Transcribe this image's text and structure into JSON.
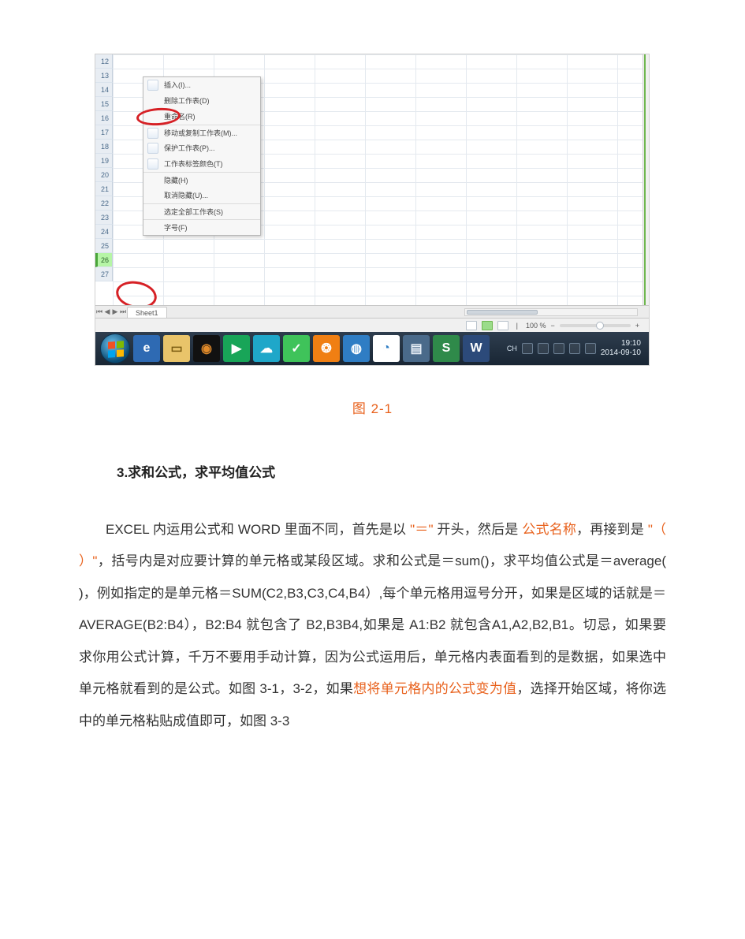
{
  "rows": [
    "12",
    "13",
    "14",
    "15",
    "16",
    "17",
    "18",
    "19",
    "20",
    "21",
    "22",
    "23",
    "24",
    "25",
    "26",
    "27"
  ],
  "selected_row_index": 14,
  "context_menu": {
    "items": [
      {
        "label": "插入(I)...",
        "icon": true
      },
      {
        "label": "删除工作表(D)"
      },
      {
        "label": "重命名(R)"
      },
      {
        "label": "移动或复制工作表(M)...",
        "icon": true,
        "sep": true
      },
      {
        "label": "保护工作表(P)...",
        "icon": true
      },
      {
        "label": "工作表标签颜色(T)",
        "icon": true
      },
      {
        "label": "隐藏(H)",
        "sep": true
      },
      {
        "label": "取消隐藏(U)..."
      },
      {
        "label": "选定全部工作表(S)",
        "sep": true
      },
      {
        "label": "字号(F)",
        "sep": true
      }
    ]
  },
  "tabs": {
    "sheet": "Sheet1"
  },
  "statusbar": {
    "zoom_label": "100 %",
    "sep": "−/+"
  },
  "taskbar": {
    "items": [
      {
        "name": "ie-icon",
        "bg": "#2e6ab3",
        "fg": "#fff",
        "sym": "e"
      },
      {
        "name": "explorer-icon",
        "bg": "#e9c46a",
        "fg": "#7a5a10",
        "sym": "▭"
      },
      {
        "name": "media-stop-icon",
        "bg": "#111",
        "fg": "#e08a2a",
        "sym": "◉"
      },
      {
        "name": "media-play-icon",
        "bg": "#18a558",
        "fg": "#fff",
        "sym": "▶"
      },
      {
        "name": "cloud-icon",
        "bg": "#1fa7c9",
        "fg": "#fff",
        "sym": "☁"
      },
      {
        "name": "leaf-icon",
        "bg": "#3fc35a",
        "fg": "#fff",
        "sym": "✓"
      },
      {
        "name": "fish-icon",
        "bg": "#f07f13",
        "fg": "#fff",
        "sym": "❂"
      },
      {
        "name": "globe-icon",
        "bg": "#2f7dc4",
        "fg": "#fff",
        "sym": "◍"
      },
      {
        "name": "chrome-icon",
        "bg": "#fff",
        "fg": "#2f7dc4",
        "sym": "◔"
      },
      {
        "name": "window-icon",
        "bg": "#4a6a8a",
        "fg": "#e6eef6",
        "sym": "▤"
      },
      {
        "name": "s-icon",
        "bg": "#2f8a4a",
        "fg": "#fff",
        "sym": "S"
      },
      {
        "name": "w-icon",
        "bg": "#2c4a7a",
        "fg": "#fff",
        "sym": "W"
      }
    ],
    "tray_lang": "CH",
    "clock_time": "19:10",
    "clock_date": "2014-09-10"
  },
  "figure_caption": "图 2-1",
  "section_heading": "3.求和公式，求平均值公式",
  "para": {
    "t1": "EXCEL 内运用公式和 WORD 里面不同，首先是以",
    "q_eq": "\"＝\"",
    "t2": "开头，然后是",
    "formula_name": "公式名称",
    "t3": "，再接到是",
    "q_paren": "\"（ ）\"",
    "t4": "，括号内是对应要计算的单元格或某段区域。求和公式是＝sum()，求平均值公式是＝average( )，例如指定的是单元格＝SUM(C2,B3,C3,C4,B4）,每个单元格用逗号分开，如果是区域的话就是＝AVERAGE(B2:B4），B2:B4 就包含了 B2,B3B4,如果是 A1:B2 就包含A1,A2,B2,B1。切忌，如果要求你用公式计算，千万不要用手动计算，因为公式运用后，单元格内表面看到的是数据，如果选中单元格就看到的是公式。如图 3-1，3-2，如果",
    "want": "想将单元格内的公式变为值",
    "t5": "，选择开始区域，将你选中的单元格粘贴成值即可，如图 3-3"
  }
}
